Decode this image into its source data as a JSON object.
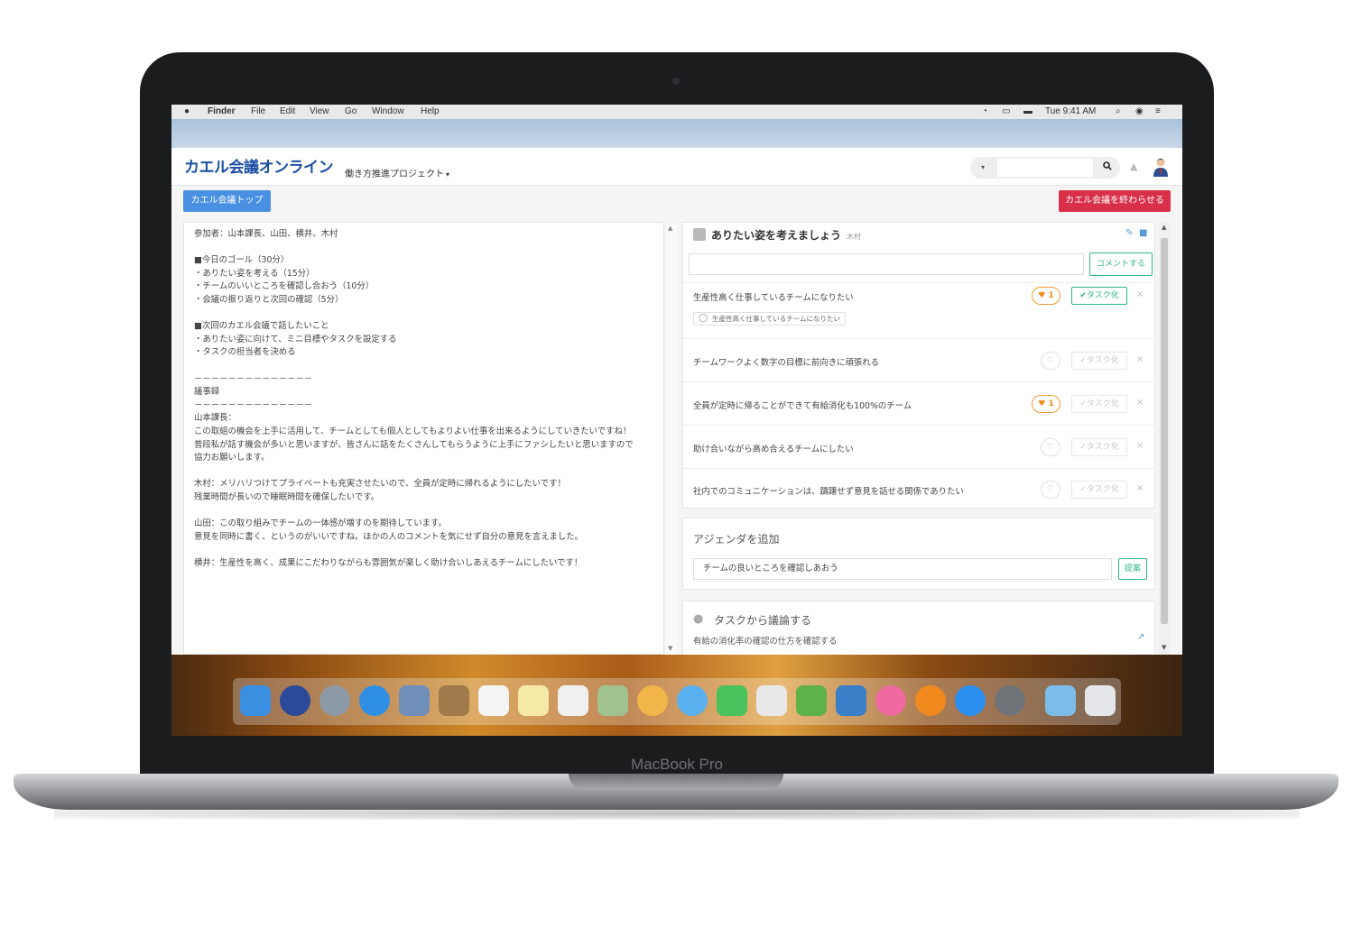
{
  "device": {
    "brand": "MacBook Pro"
  },
  "mac_menu": {
    "items": [
      "Finder",
      "File",
      "Edit",
      "View",
      "Go",
      "Window",
      "Help"
    ],
    "clock": "Tue 9:41 AM"
  },
  "header": {
    "logo": "カエル会議オンライン",
    "project": "働き方推進プロジェクト",
    "search_placeholder": ""
  },
  "toolbar": {
    "top_label": "カエル会議トップ",
    "end_label": "カエル会議を終わらせる"
  },
  "notes": {
    "text": "参加者：山本課長、山田、横井、木村\n\n■今日のゴール（30分）\n・ありたい姿を考える（15分）\n・チームのいいところを確認し合おう（10分）\n・会議の振り返りと次回の確認（5分）\n\n■次回のカエル会議で話したいこと\n・ありたい姿に向けて、ミニ目標やタスクを設定する\n・タスクの担当者を決める\n\n－－－－－－－－－－－－－－\n議事録\n－－－－－－－－－－－－－－\n山本課長：\nこの取組の機会を上手に活用して、チームとしても個人としてもよりよい仕事を出来るようにしていきたいですね！\n普段私が話す機会が多いと思いますが、皆さんに話をたくさんしてもらうように上手にファシしたいと思いますので\n協力お願いします。\n\n木村：メリハリつけてプライベートも充実させたいので、全員が定時に帰れるようにしたいです！\n残業時間が長いので睡眠時間を確保したいです。\n\n山田：この取り組みでチームの一体感が増すのを期待しています。\n意見を同時に書く、というのがいいですね。ほかの人のコメントを気にせず自分の意見を言えました。\n\n横井：生産性を高く、成果にこだわりながらも雰囲気が楽しく助け合いしあえるチームにしたいです！"
  },
  "agenda": {
    "title": "ありたい姿を考えましょう",
    "author": "木村",
    "comment_button": "コメントする",
    "task_label": "タスク化",
    "ideas": [
      {
        "text": "生産性高く仕事しているチームになりたい",
        "likes": "1",
        "liked": true,
        "tasked": true,
        "sub": "生産性高く仕事しているチームになりたい"
      },
      {
        "text": "チームワークよく数字の目標に前向きに頑張れる",
        "likes": "",
        "liked": false,
        "tasked": false
      },
      {
        "text": "全員が定時に帰ることができて有給消化も100%のチーム",
        "likes": "1",
        "liked": true,
        "tasked": false
      },
      {
        "text": "助け合いながら高め合えるチームにしたい",
        "likes": "",
        "liked": false,
        "tasked": false
      },
      {
        "text": "社内でのコミュニケーションは、躊躇せず意見を話せる関係でありたい",
        "likes": "",
        "liked": false,
        "tasked": false
      }
    ]
  },
  "add_agenda": {
    "title": "アジェンダを追加",
    "value": "チームの良いところを確認しあおう",
    "button": "提案"
  },
  "discuss": {
    "title": "タスクから議論する",
    "task": "有給の消化率の確認の仕方を確認する"
  },
  "colors": {
    "primary": "#4a90e2",
    "danger": "#d9304a",
    "success": "#2fb58c",
    "like": "#f08c1e"
  }
}
